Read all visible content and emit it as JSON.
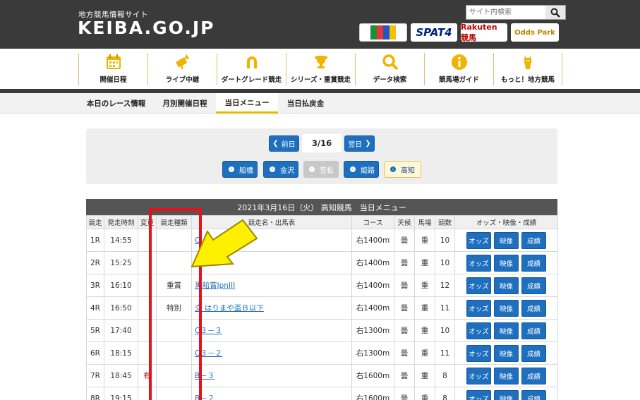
{
  "header": {
    "subtitle": "地方競馬情報サイト",
    "logo": "KEIBA.GO.JP",
    "search_placeholder": "サイト内検索",
    "banners": [
      "",
      "SPAT4",
      "Rakuten 競馬",
      "Odds Park"
    ]
  },
  "nav": [
    {
      "label": "開催日程",
      "icon": "calendar-icon"
    },
    {
      "label": "ライブ中継",
      "icon": "camera-icon"
    },
    {
      "label": "ダートグレード競走",
      "icon": "horseshoe-icon"
    },
    {
      "label": "シリーズ・重賞競走",
      "icon": "trophy-icon"
    },
    {
      "label": "データ検索",
      "icon": "search-icon"
    },
    {
      "label": "競馬場ガイド",
      "icon": "info-icon"
    },
    {
      "label": "もっと！地方競馬",
      "icon": "horse-icon"
    }
  ],
  "subnav": [
    "本日のレース情報",
    "月別開催日程",
    "当日メニュー",
    "当日払戻金"
  ],
  "date_nav": {
    "prev": "前日",
    "date": "3/16",
    "next": "翌日"
  },
  "venues": [
    "船橋",
    "金沢",
    "笠松",
    "姫路",
    "高知"
  ],
  "table": {
    "title": "2021年3月16日（火） 高知競馬　当日メニュー",
    "headers": [
      "競走",
      "発走時刻",
      "変更",
      "競走種類",
      "競走名・出馬表",
      "コース",
      "天候",
      "馬場",
      "頭数",
      "オッズ・映像・成績"
    ],
    "buttons": {
      "odds": "オッズ",
      "video": "映像",
      "result": "成績"
    },
    "rows": [
      {
        "race": "1R",
        "time": "14:55",
        "change": "",
        "kind": "",
        "name": "C",
        "course": "右1400m",
        "weather": "曇",
        "track": "重",
        "count": "10"
      },
      {
        "race": "2R",
        "time": "15:25",
        "change": "",
        "kind": "",
        "name": "",
        "course": "右1400m",
        "weather": "曇",
        "track": "重",
        "count": "10"
      },
      {
        "race": "3R",
        "time": "16:10",
        "change": "",
        "kind": "重賞",
        "name": "黒船賞JpnIII",
        "course": "右1400m",
        "weather": "曇",
        "track": "重",
        "count": "12"
      },
      {
        "race": "4R",
        "time": "16:50",
        "change": "",
        "kind": "特別",
        "name": "交 はりまや盃Ｂ以下",
        "course": "右1400m",
        "weather": "曇",
        "track": "重",
        "count": "11"
      },
      {
        "race": "5R",
        "time": "17:40",
        "change": "",
        "kind": "",
        "name": "C３－３",
        "course": "右1300m",
        "weather": "曇",
        "track": "重",
        "count": "10"
      },
      {
        "race": "6R",
        "time": "18:15",
        "change": "",
        "kind": "",
        "name": "C３－２",
        "course": "右1300m",
        "weather": "曇",
        "track": "重",
        "count": "11"
      },
      {
        "race": "7R",
        "time": "18:45",
        "change": "有",
        "kind": "",
        "name": "B－３",
        "course": "右1600m",
        "weather": "曇",
        "track": "重",
        "count": "8"
      },
      {
        "race": "8R",
        "time": "19:15",
        "change": "",
        "kind": "",
        "name": "B－２",
        "course": "右1600m",
        "weather": "曇",
        "track": "重",
        "count": "8"
      }
    ]
  },
  "colors": {
    "accent": "#1f6fbf",
    "header": "#3a3a3a",
    "gold": "#f0b400",
    "annotation": "#e8101b",
    "arrow": "#ffef00"
  }
}
